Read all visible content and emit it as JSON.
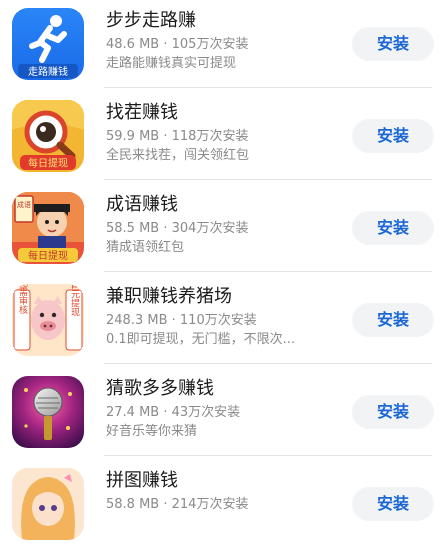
{
  "apps": [
    {
      "name": "步步走路赚",
      "size": "48.6 MB",
      "installs": "105万次安装",
      "separator": "·",
      "description": "走路能赚钱真实可提现",
      "install_label": "安装",
      "icon_text": "走路赚钱",
      "icon": "running-man-icon"
    },
    {
      "name": "找茬赚钱",
      "size": "59.9 MB",
      "installs": "118万次安装",
      "separator": "·",
      "description": "全民来找茬，闯关领红包",
      "install_label": "安装",
      "icon_text": "每日提现",
      "icon": "magnifier-eye-icon"
    },
    {
      "name": "成语赚钱",
      "size": "58.5 MB",
      "installs": "304万次安装",
      "separator": "·",
      "description": "猜成语领红包",
      "install_label": "安装",
      "icon_text": "每日提现",
      "icon_badge": "成语",
      "icon": "scholar-boy-icon"
    },
    {
      "name": "兼职赚钱养猪场",
      "size": "248.3 MB",
      "installs": "110万次安装",
      "separator": "·",
      "description": "0.1即可提现，无门槛，不限次...",
      "install_label": "安装",
      "icon_left_text": "无需审核",
      "icon_right_text": "0.1元提现",
      "icon": "pig-icon"
    },
    {
      "name": "猜歌多多赚钱",
      "size": "27.4 MB",
      "installs": "43万次安装",
      "separator": "·",
      "description": "好音乐等你来猜",
      "install_label": "安装",
      "icon": "microphone-icon"
    },
    {
      "name": "拼图赚钱",
      "size": "58.8 MB",
      "installs": "214万次安装",
      "separator": "·",
      "description": "",
      "install_label": "安装",
      "icon": "anime-girl-icon"
    }
  ],
  "colors": {
    "install_text": "#1b67d6",
    "install_bg": "#f1f3f5",
    "secondary_text": "#8a8a8a"
  }
}
